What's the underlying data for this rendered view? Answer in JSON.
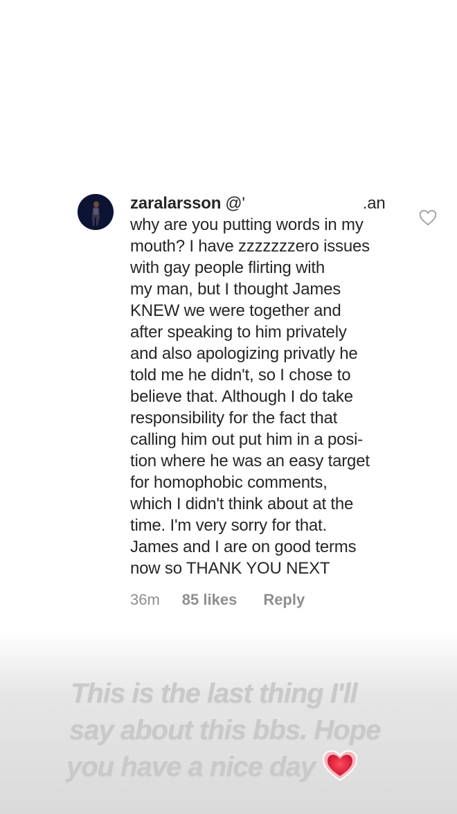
{
  "comment": {
    "username": "zaralarsson",
    "mention_start": "@'",
    "mention_end": ".an",
    "lines": [
      "why are you putting words in my",
      "mouth? I have zzzzzzzero issues",
      "with gay people flirting with",
      "my man, but I thought James",
      "KNEW we were together and",
      "after speaking to him privately",
      "and also apologizing privatly he",
      "told me he didn't, so I chose to",
      "believe that. Although I do take",
      "responsibility for the fact that",
      "calling him out put him in a posi-",
      "tion where he was an easy target",
      "for homophobic comments,",
      "which I didn't think about at the",
      "time. I'm very sorry for that.",
      "James and I are on good terms",
      "now so THANK YOU NEXT"
    ],
    "time": "36m",
    "likes": "85 likes",
    "reply": "Reply"
  },
  "caption": {
    "lines": [
      "This is the last thing I'll",
      "say about this bbs. Hope",
      "you have a nice day"
    ]
  },
  "icons": {
    "like": "heart-outline-icon",
    "sticker": "heart-sticker-icon"
  },
  "colors": {
    "text": "#262626",
    "meta": "#8e8e8e",
    "caption": "#c9c9c9",
    "heart_sticker": "#e0243a"
  }
}
